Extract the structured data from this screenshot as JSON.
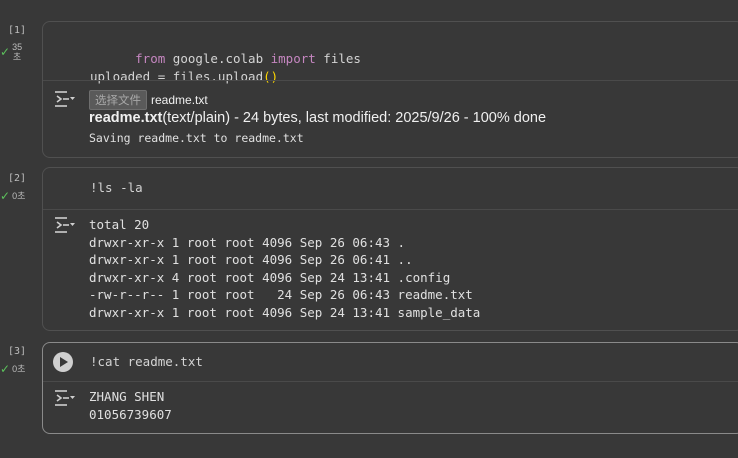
{
  "colors": {
    "background": "#383838",
    "check": "#5cc15c",
    "keyword": "#c586c0",
    "paren": "#ffd700"
  },
  "cells": [
    {
      "exec_count": "[1]",
      "status": {
        "icon": "check-icon",
        "line1": "35",
        "line2": "초"
      },
      "code": {
        "kw1": "from",
        "mod": " google.colab ",
        "kw2": "import",
        "rest": " files",
        "line2a": "uploaded = files.upload",
        "paren": "()"
      },
      "output": {
        "file_button_label": "选择文件",
        "file_name": "readme.txt",
        "status_bold": "readme.txt",
        "status_rest": "(text/plain) - 24 bytes, last modified: 2025/9/26 - 100% done",
        "saving": "Saving readme.txt to readme.txt"
      }
    },
    {
      "exec_count": "[2]",
      "status": {
        "icon": "check-icon",
        "label": "0초"
      },
      "code": "!ls -la",
      "output": "total 20\ndrwxr-xr-x 1 root root 4096 Sep 26 06:43 .\ndrwxr-xr-x 1 root root 4096 Sep 26 06:41 ..\ndrwxr-xr-x 4 root root 4096 Sep 24 13:41 .config\n-rw-r--r-- 1 root root   24 Sep 26 06:43 readme.txt\ndrwxr-xr-x 1 root root 4096 Sep 24 13:41 sample_data"
    },
    {
      "exec_count": "[3]",
      "status": {
        "icon": "check-icon",
        "label": "0초"
      },
      "code": "!cat readme.txt",
      "output": "ZHANG SHEN\n01056739607"
    }
  ]
}
